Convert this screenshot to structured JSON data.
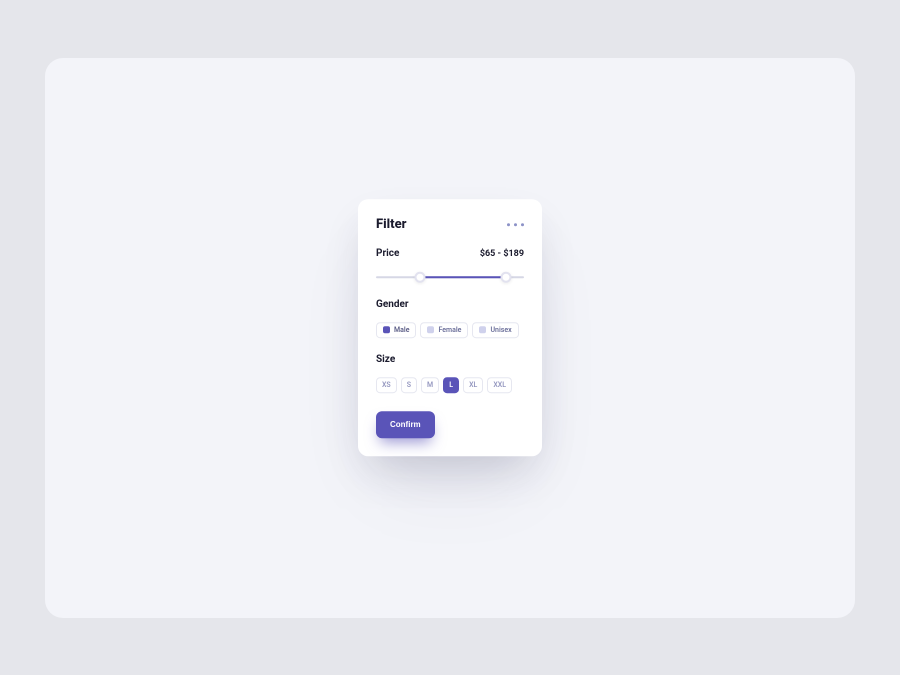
{
  "filter": {
    "title": "Filter",
    "price": {
      "label": "Price",
      "display": "$65 - $189"
    },
    "gender": {
      "label": "Gender",
      "options": {
        "male": "Male",
        "female": "Female",
        "unisex": "Unisex"
      },
      "selected": "Male"
    },
    "size": {
      "label": "Size",
      "options": {
        "xs": "XS",
        "s": "S",
        "m": "M",
        "l": "L",
        "xl": "XL",
        "xxl": "XXL"
      },
      "selected": "L"
    },
    "confirm_label": "Confirm"
  }
}
